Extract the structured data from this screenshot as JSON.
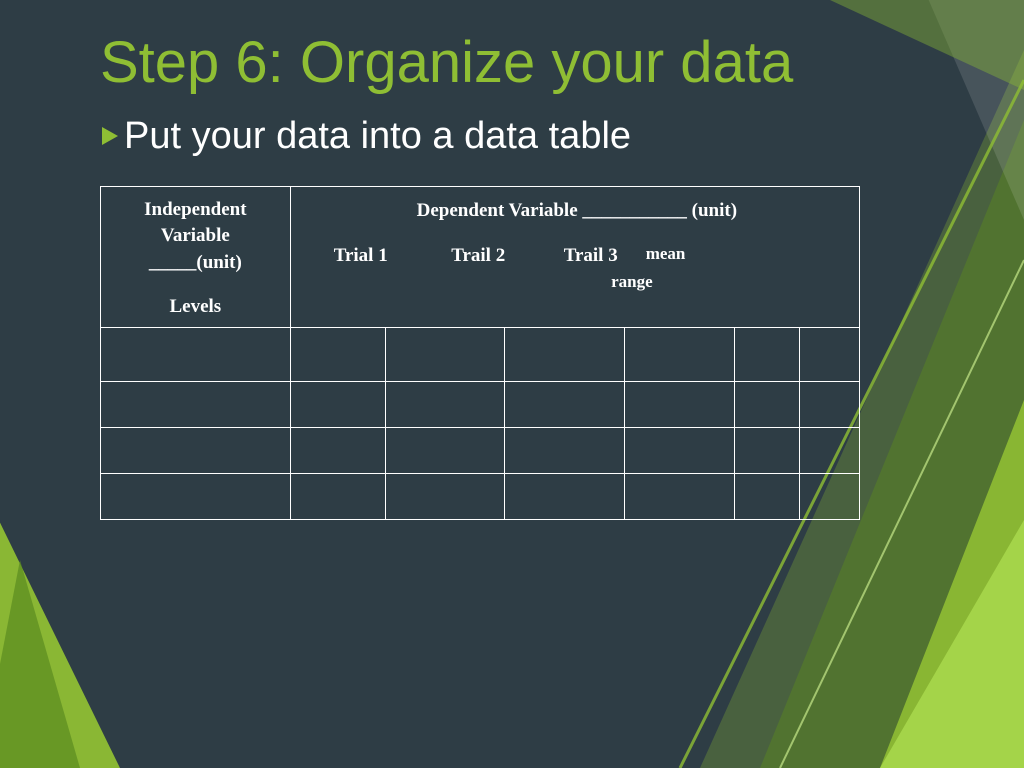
{
  "title": "Step 6: Organize your data",
  "bullet": "Put your data into a data table",
  "table": {
    "iv_header_line1": "Independent",
    "iv_header_line2": "Variable",
    "iv_header_line3": "_____(unit)",
    "iv_header_levels": "Levels",
    "dv_header": "Dependent Variable ___________  (unit)",
    "trial1": "Trial 1",
    "trial2": "Trail 2",
    "trial3": "Trail 3",
    "mean": "mean",
    "range": "range"
  }
}
